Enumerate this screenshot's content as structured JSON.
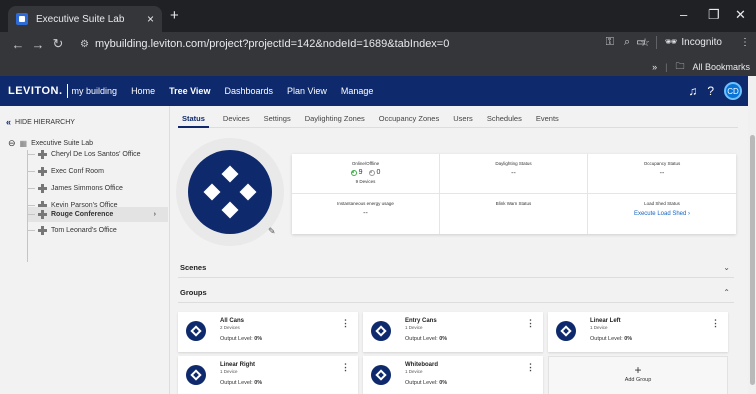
{
  "browser": {
    "tab_title": "Executive Suite Lab",
    "tab_close": "×",
    "new_tab": "+",
    "url": "mybuilding.leviton.com/project?projectId=142&nodeId=1689&tabIndex=0",
    "incognito_label": "Incognito",
    "bookmarks_chevron": "»",
    "all_bookmarks": "All Bookmarks"
  },
  "app": {
    "brand": "LEVITON.",
    "subbrand": "my building",
    "nav": [
      "Home",
      "Tree View",
      "Dashboards",
      "Plan View",
      "Manage"
    ],
    "active_nav": "Tree View",
    "avatar_initials": "CD"
  },
  "sidebar": {
    "hide_label": "HIDE HIERARCHY",
    "root": "Executive Suite Lab",
    "items": [
      "Cheryl De Los Santos' Office",
      "Exec Conf Room",
      "James Simmons Office",
      "Kevin Parson's Office",
      "Rouge Conference",
      "Tom Leonard's Office"
    ],
    "selected": "Rouge Conference"
  },
  "tabs": [
    "Status",
    "Devices",
    "Settings",
    "Daylighting Zones",
    "Occupancy Zones",
    "Users",
    "Schedules",
    "Events"
  ],
  "active_tab": "Status",
  "status": {
    "online_offline_label": "Online/Offline",
    "online_count": "9",
    "offline_count": "0",
    "devices_count": "9 Devices",
    "daylighting_label": "Daylighting Status",
    "daylighting_value": "--",
    "occupancy_label": "Occupancy Status",
    "occupancy_value": "--",
    "energy_label": "Instantaneous energy usage",
    "energy_value": "--",
    "blink_label": "Blink Warn Status",
    "load_shed_label": "Load Shed Status",
    "load_shed_link": "Execute Load Shed  ›"
  },
  "sections": {
    "scenes": "Scenes",
    "groups": "Groups"
  },
  "groups": [
    {
      "name": "All Cans",
      "devices": "2 Devices",
      "output_label": "Output Level:",
      "output": "0%"
    },
    {
      "name": "Entry Cans",
      "devices": "1 Device",
      "output_label": "Output Level:",
      "output": "0%"
    },
    {
      "name": "Linear Left",
      "devices": "1 Device",
      "output_label": "Output Level:",
      "output": "0%"
    },
    {
      "name": "Linear Right",
      "devices": "1 Device",
      "output_label": "Output Level:",
      "output": "0%"
    },
    {
      "name": "Whiteboard",
      "devices": "1 Device",
      "output_label": "Output Level:",
      "output": "0%"
    }
  ],
  "add_group": "Add Group",
  "colors": {
    "brand_navy": "#0e2a6d",
    "online_green": "#3cb043",
    "link_blue": "#1565c0",
    "avatar_blue": "#0a74d6"
  }
}
